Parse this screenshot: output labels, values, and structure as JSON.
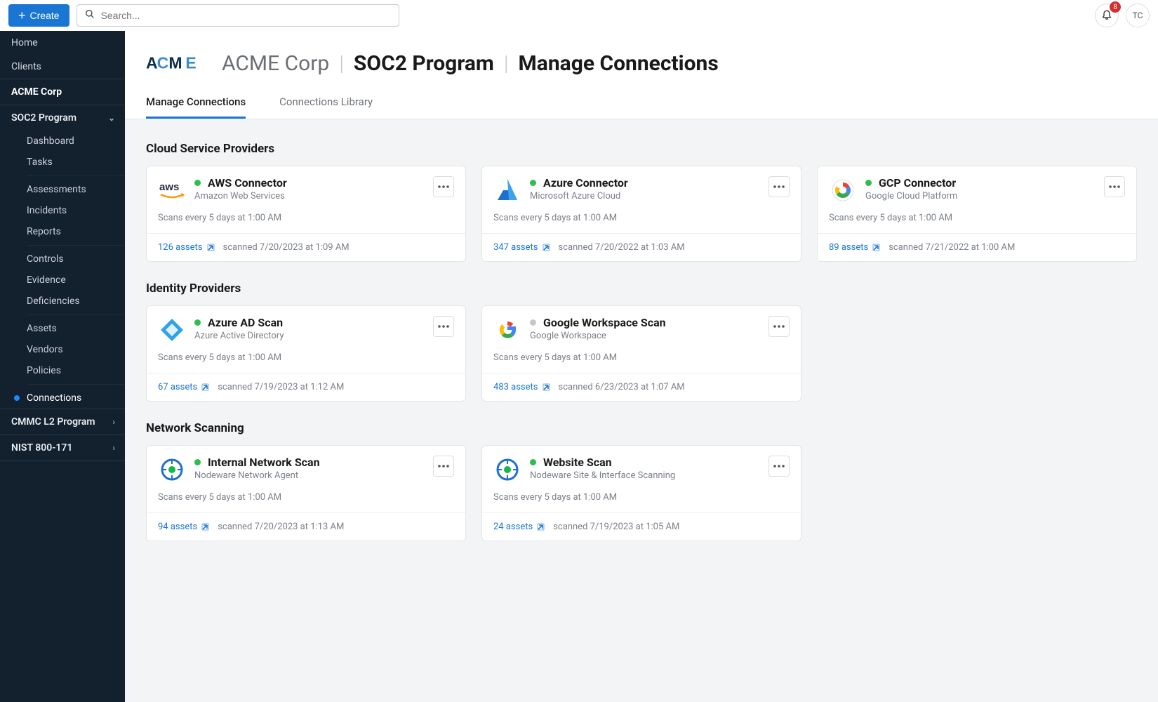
{
  "topbar": {
    "create_label": "Create",
    "search_placeholder": "Search...",
    "badge": "8",
    "avatar": "TC"
  },
  "sidebar": {
    "home": "Home",
    "clients": "Clients",
    "org": "ACME Corp",
    "programs": [
      {
        "name": "SOC2 Program",
        "expanded": true
      },
      {
        "name": "CMMC L2 Program",
        "expanded": false
      },
      {
        "name": "NIST 800-171",
        "expanded": false
      }
    ],
    "soc2_items": {
      "g1": [
        "Dashboard",
        "Tasks"
      ],
      "g2": [
        "Assessments",
        "Incidents",
        "Reports"
      ],
      "g3": [
        "Controls",
        "Evidence",
        "Deficiencies"
      ],
      "g4": [
        "Assets",
        "Vendors",
        "Policies"
      ],
      "g5": [
        "Connections"
      ]
    }
  },
  "breadcrumb": {
    "org": "ACME Corp",
    "program": "SOC2 Program",
    "page": "Manage Connections"
  },
  "tabs": [
    {
      "label": "Manage Connections",
      "active": true
    },
    {
      "label": "Connections Library",
      "active": false
    }
  ],
  "sections": [
    {
      "title": "Cloud Service Providers",
      "cards": [
        {
          "icon": "aws",
          "status": "green",
          "title": "AWS Connector",
          "subtitle": "Amazon Web Services",
          "schedule": "Scans every 5 days at 1:00 AM",
          "assets": "126 assets",
          "scanned": "scanned 7/20/2023 at 1:09 AM"
        },
        {
          "icon": "azure",
          "status": "green",
          "title": "Azure Connector",
          "subtitle": "Microsoft Azure Cloud",
          "schedule": "Scans every 5 days at 1:00 AM",
          "assets": "347 assets",
          "scanned": "scanned 7/20/2022 at 1:03 AM"
        },
        {
          "icon": "gcp",
          "status": "green",
          "title": "GCP Connector",
          "subtitle": "Google Cloud Platform",
          "schedule": "Scans every 5 days at 1:00 AM",
          "assets": "89 assets",
          "scanned": "scanned 7/21/2022 at 1:00 AM"
        }
      ]
    },
    {
      "title": "Identity Providers",
      "cards": [
        {
          "icon": "aad",
          "status": "green",
          "title": "Azure AD Scan",
          "subtitle": "Azure Active Directory",
          "schedule": "Scans every 5 days at 1:00 AM",
          "assets": "67 assets",
          "scanned": "scanned 7/19/2023 at 1:12 AM"
        },
        {
          "icon": "google",
          "status": "grey",
          "title": "Google Workspace Scan",
          "subtitle": "Google Workspace",
          "schedule": "Scans every 5 days at 1:00 AM",
          "assets": "483 assets",
          "scanned": "scanned 6/23/2023 at 1:07 AM"
        }
      ]
    },
    {
      "title": "Network Scanning",
      "cards": [
        {
          "icon": "nodeware",
          "status": "green",
          "title": "Internal Network Scan",
          "subtitle": "Nodeware Network Agent",
          "schedule": "Scans every 5 days at 1:00 AM",
          "assets": "94 assets",
          "scanned": "scanned 7/20/2023 at 1:13 AM"
        },
        {
          "icon": "nodeware",
          "status": "green",
          "title": "Website Scan",
          "subtitle": "Nodeware Site & Interface Scanning",
          "schedule": "Scans every 5 days at 1:00 AM",
          "assets": "24 assets",
          "scanned": "scanned 7/19/2023 at 1:05 AM"
        }
      ]
    }
  ]
}
